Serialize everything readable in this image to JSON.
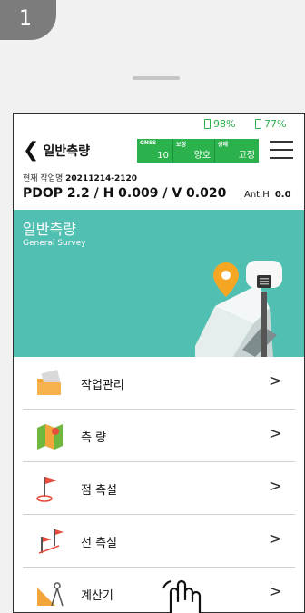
{
  "step_badge": "1",
  "status": {
    "battery_a": "98%",
    "battery_b": "77%"
  },
  "header": {
    "back_label": "일반측량",
    "info": [
      {
        "caption": "GNSS",
        "value": "10"
      },
      {
        "caption": "보정",
        "value": "양호"
      },
      {
        "caption": "상태",
        "value": "고정"
      }
    ]
  },
  "job": {
    "label": "현재 작업명",
    "name": "20211214-2120"
  },
  "pdop": "PDOP 2.2 / H 0.009 / V 0.020",
  "ant_h": {
    "label": "Ant.H",
    "value": "0.0"
  },
  "banner": {
    "title": "일반측량",
    "subtitle": "General Survey"
  },
  "menu": [
    {
      "label": "작업관리",
      "icon": "folder-icon"
    },
    {
      "label": "측 량",
      "icon": "map-icon"
    },
    {
      "label": "점 측설",
      "icon": "flag-icon"
    },
    {
      "label": "선 측설",
      "icon": "flags-icon"
    },
    {
      "label": "계산기",
      "icon": "calculator-icon"
    }
  ],
  "arrow_glyph": ">",
  "colors": {
    "accent_green": "#2bb24c",
    "banner_teal": "#51bfb1"
  }
}
